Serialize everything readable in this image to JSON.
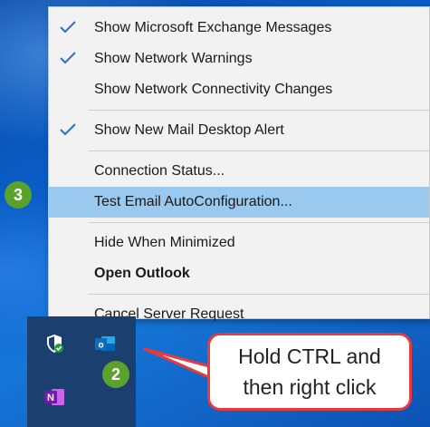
{
  "context_menu": {
    "items": [
      {
        "label": "Show Microsoft Exchange Messages",
        "checked": true
      },
      {
        "label": "Show Network Warnings",
        "checked": true
      },
      {
        "label": "Show Network Connectivity Changes",
        "checked": false
      },
      {
        "label": "Show New Mail Desktop Alert",
        "checked": true
      },
      {
        "label": "Connection Status...",
        "checked": false
      },
      {
        "label": "Test Email AutoConfiguration...",
        "checked": false,
        "highlighted": true
      },
      {
        "label": "Hide When Minimized",
        "checked": false
      },
      {
        "label": "Open Outlook",
        "checked": false,
        "bold": true
      },
      {
        "label": "Cancel Server Request",
        "checked": false
      }
    ]
  },
  "badges": {
    "step3": "3",
    "step2": "2"
  },
  "tray": {
    "icons": [
      "windows-defender-shield-icon",
      "outlook-icon",
      "onenote-icon"
    ],
    "outlook_letter": "o",
    "onenote_letter": "N"
  },
  "callout": {
    "line1": "Hold CTRL and",
    "line2": "then right click"
  },
  "colors": {
    "highlight": "#99c9ef",
    "badge": "#5aa22c",
    "callout_border": "#e8393d",
    "checkmark": "#2e6fc0"
  }
}
